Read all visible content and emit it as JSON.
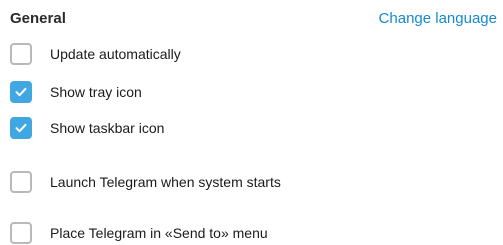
{
  "general": {
    "title": "General",
    "change_language": "Change language"
  },
  "options": [
    {
      "label": "Update automatically",
      "checked": false
    },
    {
      "label": "Show tray icon",
      "checked": true
    },
    {
      "label": "Show taskbar icon",
      "checked": true
    },
    {
      "label": "Launch Telegram when system starts",
      "checked": false
    },
    {
      "label": "Place Telegram in «Send to» menu",
      "checked": false
    }
  ],
  "colors": {
    "accent": "#40a7e3",
    "link": "#168acd",
    "checkbox_border": "#b9b9b9"
  },
  "icons": {
    "checkmark": "checkmark-icon"
  }
}
